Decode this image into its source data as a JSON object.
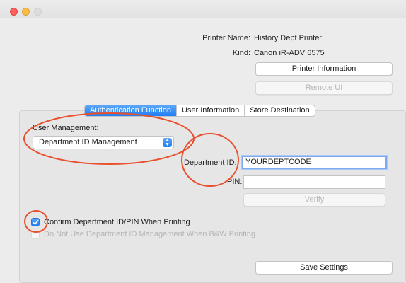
{
  "printer": {
    "name_label": "Printer Name:",
    "name_value": "History Dept Printer",
    "kind_label": "Kind:",
    "kind_value": "Canon iR-ADV 6575",
    "info_button": "Printer Information",
    "remote_ui_button": "Remote UI"
  },
  "tabs": [
    {
      "label": "Authentication Function",
      "active": true
    },
    {
      "label": "User Information",
      "active": false
    },
    {
      "label": "Store Destination",
      "active": false
    }
  ],
  "user_management": {
    "label": "User Management:",
    "selected": "Department ID Management"
  },
  "department": {
    "id_label": "Department ID:",
    "id_value": "YOURDEPTCODE",
    "pin_label": "PIN:",
    "pin_value": "",
    "verify_button": "Verify"
  },
  "options": {
    "confirm_label": "Confirm Department ID/PIN When Printing",
    "confirm_checked": true,
    "bw_label": "Do Not Use Department ID Management When B&W Printing",
    "bw_checked": false
  },
  "footer": {
    "save_button": "Save Settings"
  },
  "colors": {
    "accent": "#1f7ef3",
    "annotation": "#e8502e"
  }
}
